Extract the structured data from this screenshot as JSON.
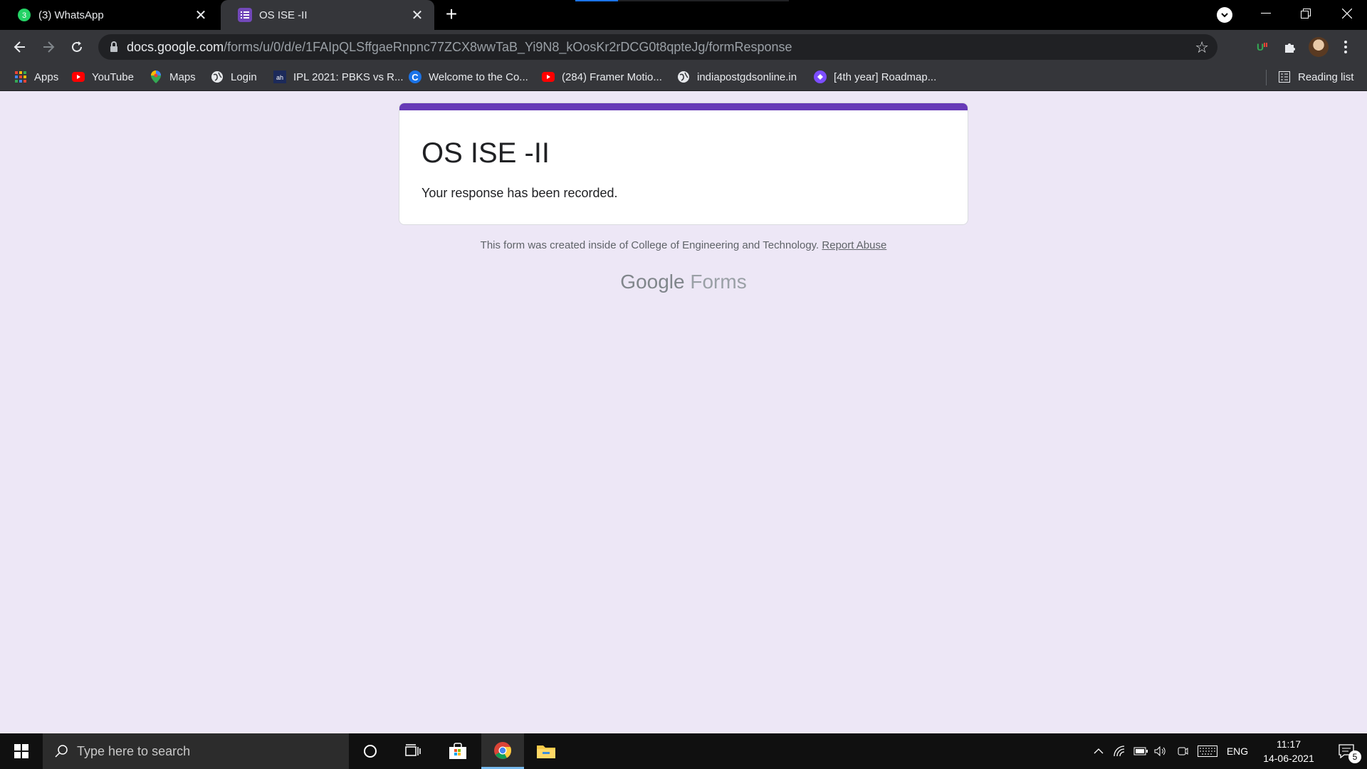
{
  "browser": {
    "tabs": [
      {
        "title": "(3) WhatsApp",
        "favicon": "whatsapp-icon",
        "badge": "3"
      },
      {
        "title": "OS ISE -II",
        "favicon": "google-forms-icon",
        "active": true
      }
    ],
    "omnibox": {
      "host": "docs.google.com",
      "path": "/forms/u/0/d/e/1FAIpQLSffgaeRnpnc77ZCX8wwTaB_Yi9N8_kOosKr2rDCG0t8qpteJg/formResponse"
    }
  },
  "bookmarks": {
    "items": [
      {
        "label": "Apps",
        "icon": "apps-grid-icon"
      },
      {
        "label": "YouTube",
        "icon": "youtube-icon"
      },
      {
        "label": "Maps",
        "icon": "maps-icon"
      },
      {
        "label": "Login",
        "icon": "globe-icon"
      },
      {
        "label": "IPL 2021: PBKS vs R...",
        "icon": "cricket-site-icon"
      },
      {
        "label": "Welcome to the Co...",
        "icon": "c-logo-icon"
      },
      {
        "label": "(284) Framer Motio...",
        "icon": "youtube-icon"
      },
      {
        "label": "indiapostgdsonline.in",
        "icon": "globe-icon"
      },
      {
        "label": "[4th year] Roadmap...",
        "icon": "roadmap-icon"
      }
    ],
    "reading_list": "Reading list"
  },
  "page": {
    "form_title": "OS ISE -II",
    "message": "Your response has been recorded.",
    "footer_text": "This form was created inside of College of Engineering and Technology.",
    "report_link": "Report Abuse",
    "brand_google": "Google",
    "brand_forms": "Forms",
    "accent_color": "#673ab7",
    "background_color": "#ede7f6"
  },
  "taskbar": {
    "search_placeholder": "Type here to search",
    "language": "ENG",
    "time": "11:17",
    "date": "14-06-2021",
    "notification_count": "5"
  }
}
